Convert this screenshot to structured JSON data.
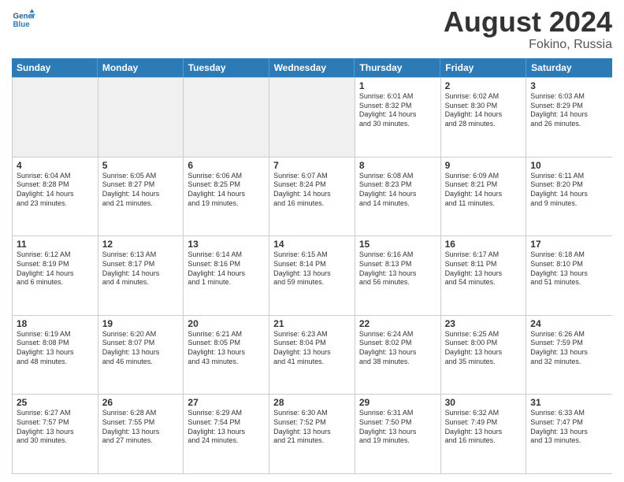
{
  "header": {
    "logo_general": "General",
    "logo_blue": "Blue",
    "month_title": "August 2024",
    "location": "Fokino, Russia"
  },
  "days_of_week": [
    "Sunday",
    "Monday",
    "Tuesday",
    "Wednesday",
    "Thursday",
    "Friday",
    "Saturday"
  ],
  "weeks": [
    [
      {
        "day": "",
        "info": "",
        "shaded": true
      },
      {
        "day": "",
        "info": "",
        "shaded": true
      },
      {
        "day": "",
        "info": "",
        "shaded": true
      },
      {
        "day": "",
        "info": "",
        "shaded": true
      },
      {
        "day": "1",
        "info": "Sunrise: 6:01 AM\nSunset: 8:32 PM\nDaylight: 14 hours\nand 30 minutes."
      },
      {
        "day": "2",
        "info": "Sunrise: 6:02 AM\nSunset: 8:30 PM\nDaylight: 14 hours\nand 28 minutes."
      },
      {
        "day": "3",
        "info": "Sunrise: 6:03 AM\nSunset: 8:29 PM\nDaylight: 14 hours\nand 26 minutes."
      }
    ],
    [
      {
        "day": "4",
        "info": "Sunrise: 6:04 AM\nSunset: 8:28 PM\nDaylight: 14 hours\nand 23 minutes."
      },
      {
        "day": "5",
        "info": "Sunrise: 6:05 AM\nSunset: 8:27 PM\nDaylight: 14 hours\nand 21 minutes."
      },
      {
        "day": "6",
        "info": "Sunrise: 6:06 AM\nSunset: 8:25 PM\nDaylight: 14 hours\nand 19 minutes."
      },
      {
        "day": "7",
        "info": "Sunrise: 6:07 AM\nSunset: 8:24 PM\nDaylight: 14 hours\nand 16 minutes."
      },
      {
        "day": "8",
        "info": "Sunrise: 6:08 AM\nSunset: 8:23 PM\nDaylight: 14 hours\nand 14 minutes."
      },
      {
        "day": "9",
        "info": "Sunrise: 6:09 AM\nSunset: 8:21 PM\nDaylight: 14 hours\nand 11 minutes."
      },
      {
        "day": "10",
        "info": "Sunrise: 6:11 AM\nSunset: 8:20 PM\nDaylight: 14 hours\nand 9 minutes."
      }
    ],
    [
      {
        "day": "11",
        "info": "Sunrise: 6:12 AM\nSunset: 8:19 PM\nDaylight: 14 hours\nand 6 minutes."
      },
      {
        "day": "12",
        "info": "Sunrise: 6:13 AM\nSunset: 8:17 PM\nDaylight: 14 hours\nand 4 minutes."
      },
      {
        "day": "13",
        "info": "Sunrise: 6:14 AM\nSunset: 8:16 PM\nDaylight: 14 hours\nand 1 minute."
      },
      {
        "day": "14",
        "info": "Sunrise: 6:15 AM\nSunset: 8:14 PM\nDaylight: 13 hours\nand 59 minutes."
      },
      {
        "day": "15",
        "info": "Sunrise: 6:16 AM\nSunset: 8:13 PM\nDaylight: 13 hours\nand 56 minutes."
      },
      {
        "day": "16",
        "info": "Sunrise: 6:17 AM\nSunset: 8:11 PM\nDaylight: 13 hours\nand 54 minutes."
      },
      {
        "day": "17",
        "info": "Sunrise: 6:18 AM\nSunset: 8:10 PM\nDaylight: 13 hours\nand 51 minutes."
      }
    ],
    [
      {
        "day": "18",
        "info": "Sunrise: 6:19 AM\nSunset: 8:08 PM\nDaylight: 13 hours\nand 48 minutes."
      },
      {
        "day": "19",
        "info": "Sunrise: 6:20 AM\nSunset: 8:07 PM\nDaylight: 13 hours\nand 46 minutes."
      },
      {
        "day": "20",
        "info": "Sunrise: 6:21 AM\nSunset: 8:05 PM\nDaylight: 13 hours\nand 43 minutes."
      },
      {
        "day": "21",
        "info": "Sunrise: 6:23 AM\nSunset: 8:04 PM\nDaylight: 13 hours\nand 41 minutes."
      },
      {
        "day": "22",
        "info": "Sunrise: 6:24 AM\nSunset: 8:02 PM\nDaylight: 13 hours\nand 38 minutes."
      },
      {
        "day": "23",
        "info": "Sunrise: 6:25 AM\nSunset: 8:00 PM\nDaylight: 13 hours\nand 35 minutes."
      },
      {
        "day": "24",
        "info": "Sunrise: 6:26 AM\nSunset: 7:59 PM\nDaylight: 13 hours\nand 32 minutes."
      }
    ],
    [
      {
        "day": "25",
        "info": "Sunrise: 6:27 AM\nSunset: 7:57 PM\nDaylight: 13 hours\nand 30 minutes."
      },
      {
        "day": "26",
        "info": "Sunrise: 6:28 AM\nSunset: 7:55 PM\nDaylight: 13 hours\nand 27 minutes."
      },
      {
        "day": "27",
        "info": "Sunrise: 6:29 AM\nSunset: 7:54 PM\nDaylight: 13 hours\nand 24 minutes."
      },
      {
        "day": "28",
        "info": "Sunrise: 6:30 AM\nSunset: 7:52 PM\nDaylight: 13 hours\nand 21 minutes."
      },
      {
        "day": "29",
        "info": "Sunrise: 6:31 AM\nSunset: 7:50 PM\nDaylight: 13 hours\nand 19 minutes."
      },
      {
        "day": "30",
        "info": "Sunrise: 6:32 AM\nSunset: 7:49 PM\nDaylight: 13 hours\nand 16 minutes."
      },
      {
        "day": "31",
        "info": "Sunrise: 6:33 AM\nSunset: 7:47 PM\nDaylight: 13 hours\nand 13 minutes."
      }
    ]
  ]
}
